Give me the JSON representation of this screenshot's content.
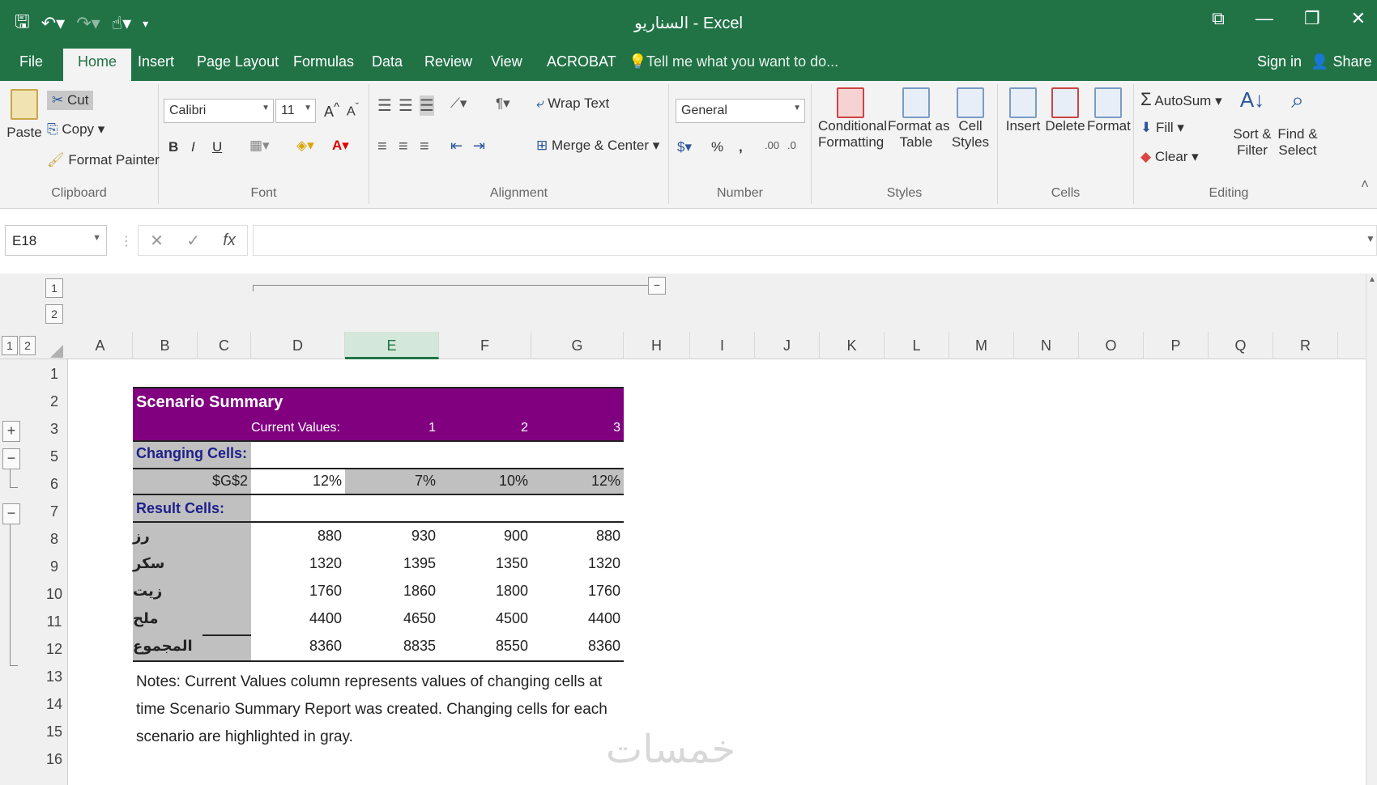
{
  "window": {
    "title": "السناريو - Excel",
    "controls": [
      "⧉",
      "—",
      "❐",
      "✕"
    ]
  },
  "tabs": {
    "file": "File",
    "home": "Home",
    "insert": "Insert",
    "page_layout": "Page Layout",
    "formulas": "Formulas",
    "data": "Data",
    "review": "Review",
    "view": "View",
    "acrobat": "ACROBAT",
    "tell_me": "Tell me what you want to do...",
    "sign_in": "Sign in",
    "share": "Share"
  },
  "ribbon": {
    "clipboard": {
      "label": "Clipboard",
      "paste": "Paste",
      "cut": "Cut",
      "copy": "Copy",
      "format_painter": "Format Painter"
    },
    "font": {
      "label": "Font",
      "family": "Calibri",
      "size": "11",
      "bold": "B",
      "italic": "I",
      "underline": "U"
    },
    "alignment": {
      "label": "Alignment",
      "wrap_text": "Wrap Text",
      "merge_center": "Merge & Center"
    },
    "number": {
      "label": "Number",
      "format": "General",
      "percent": "%",
      "comma": ","
    },
    "styles": {
      "label": "Styles",
      "conditional": "Conditional",
      "conditional2": "Formatting",
      "format_as": "Format as",
      "format_as2": "Table",
      "cell": "Cell",
      "cell2": "Styles"
    },
    "cells": {
      "label": "Cells",
      "insert": "Insert",
      "delete": "Delete",
      "format": "Format"
    },
    "editing": {
      "label": "Editing",
      "autosum": "AutoSum",
      "fill": "Fill",
      "clear": "Clear",
      "sort": "Sort &",
      "sort2": "Filter",
      "find": "Find &",
      "find2": "Select"
    }
  },
  "formula_bar": {
    "name_box": "E18",
    "fx": "fx",
    "value": ""
  },
  "outline_levels": [
    "1",
    "2"
  ],
  "column_headers": [
    "A",
    "B",
    "C",
    "D",
    "E",
    "F",
    "G",
    "H",
    "I",
    "J",
    "K",
    "L",
    "M",
    "N",
    "O",
    "P",
    "Q",
    "R"
  ],
  "selected_column": "E",
  "row_numbers": [
    "1",
    "2",
    "3",
    "5",
    "6",
    "7",
    "8",
    "9",
    "10",
    "11",
    "12",
    "13",
    "14",
    "15",
    "16"
  ],
  "sheet": {
    "title": "Scenario Summary",
    "current_values_label": "Current Values:",
    "scenario_numbers": [
      "1",
      "2",
      "3"
    ],
    "changing_cells_label": "Changing Cells:",
    "changing_cell": {
      "name": "$G$2",
      "values": [
        "12%",
        "7%",
        "10%",
        "12%"
      ]
    },
    "result_cells_label": "Result Cells:",
    "results": [
      {
        "name": "رز",
        "values": [
          "880",
          "930",
          "900",
          "880"
        ]
      },
      {
        "name": "سكر",
        "values": [
          "1320",
          "1395",
          "1350",
          "1320"
        ]
      },
      {
        "name": "زيت",
        "values": [
          "1760",
          "1860",
          "1800",
          "1760"
        ]
      },
      {
        "name": "ملح",
        "values": [
          "4400",
          "4650",
          "4500",
          "4400"
        ]
      },
      {
        "name": "المجموع",
        "values": [
          "8360",
          "8835",
          "8550",
          "8360"
        ]
      }
    ],
    "notes": [
      "Notes:  Current Values column represents values of changing cells at",
      "time Scenario Summary Report was created.  Changing cells for each",
      "scenario are highlighted in gray."
    ]
  },
  "watermark": "خمسات",
  "colors": {
    "excel_green": "#217346",
    "header_purple": "#800080",
    "changing_gray": "#c0c0c0",
    "label_navy": "#1f1f8c"
  }
}
